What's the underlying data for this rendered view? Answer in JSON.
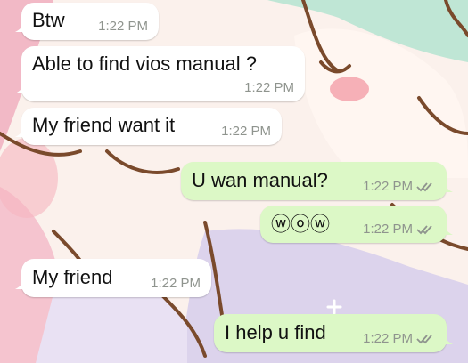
{
  "colors": {
    "incoming_bubble": "#ffffff",
    "outgoing_bubble": "#dcf8c6",
    "timestamp": "#8f948e",
    "read_ticks": "#8f948e",
    "wallpaper_base": "#fbf1ec"
  },
  "wallpaper": {
    "icon": "cartoon-wallpaper"
  },
  "messages": [
    {
      "direction": "incoming",
      "text": "Btw",
      "time": "1:22 PM"
    },
    {
      "direction": "incoming",
      "text": "Able to find vios manual ?",
      "time": "1:22 PM"
    },
    {
      "direction": "incoming",
      "text": "My friend want it",
      "time": "1:22 PM"
    },
    {
      "direction": "outgoing",
      "text": "U wan manual?",
      "time": "1:22 PM",
      "status_icon": "double-check-icon"
    },
    {
      "direction": "outgoing",
      "text": "ⓦⓞⓦ",
      "time": "1:22 PM",
      "status_icon": "double-check-icon"
    },
    {
      "direction": "incoming",
      "text": "My friend",
      "time": "1:22 PM"
    },
    {
      "direction": "outgoing",
      "text": "I help u find",
      "time": "1:22 PM",
      "status_icon": "double-check-icon"
    }
  ]
}
